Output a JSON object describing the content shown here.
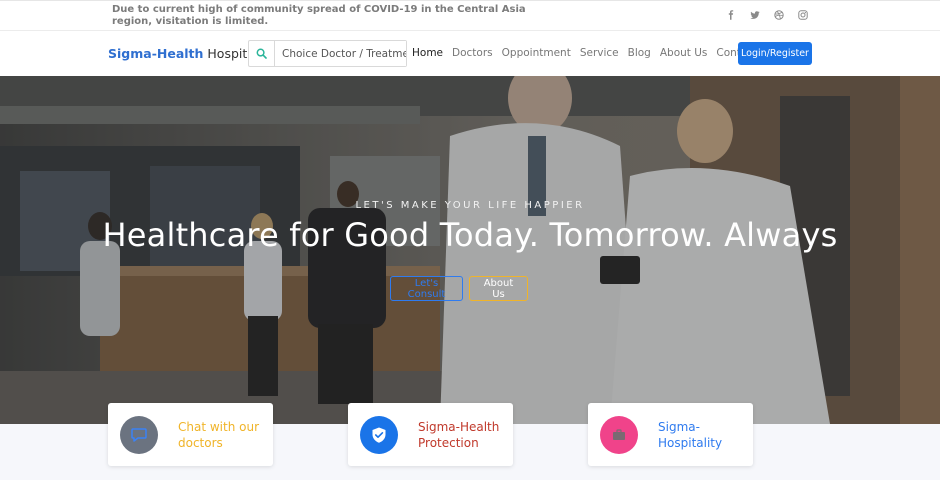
{
  "notice": "Due to current high of community spread of COVID-19 in the Central Asia region, visitation is limited.",
  "social": [
    "facebook-icon",
    "twitter-icon",
    "dribbble-icon",
    "instagram-icon"
  ],
  "brand": {
    "part1": "Sigma-Health",
    "part2": " Hospital"
  },
  "search": {
    "placeholder": "Choice Doctor / Treatment"
  },
  "nav": {
    "items": [
      "Home",
      "Doctors",
      "Oppointment",
      "Service",
      "Blog",
      "About Us",
      "Contact"
    ],
    "active": "Home"
  },
  "login_label": "Login/Register",
  "hero": {
    "eyebrow": "LET'S MAKE YOUR LIFE HAPPIER",
    "headline": "Healthcare for Good Today. Tomorrow. Always",
    "btn_consult": "Let's Consult",
    "btn_about": "About Us"
  },
  "cards": [
    {
      "line1": "Chat with our",
      "line2": "doctors",
      "icon": "chat-icon",
      "circle_color": "#6b7380",
      "text_color": "#f0b429"
    },
    {
      "line1": "Sigma-Health",
      "line2": "Protection",
      "icon": "shield-icon",
      "circle_color": "#1a74e8",
      "text_color": "#c0392b"
    },
    {
      "line1": "Sigma-",
      "line2": "Hospitality",
      "icon": "briefcase-icon",
      "circle_color": "#f0438a",
      "text_color": "#2f7bef"
    }
  ],
  "colors": {
    "primary": "#1a74e8",
    "accent_gold": "#f0b429",
    "brand_blue": "#2f6fd0"
  }
}
